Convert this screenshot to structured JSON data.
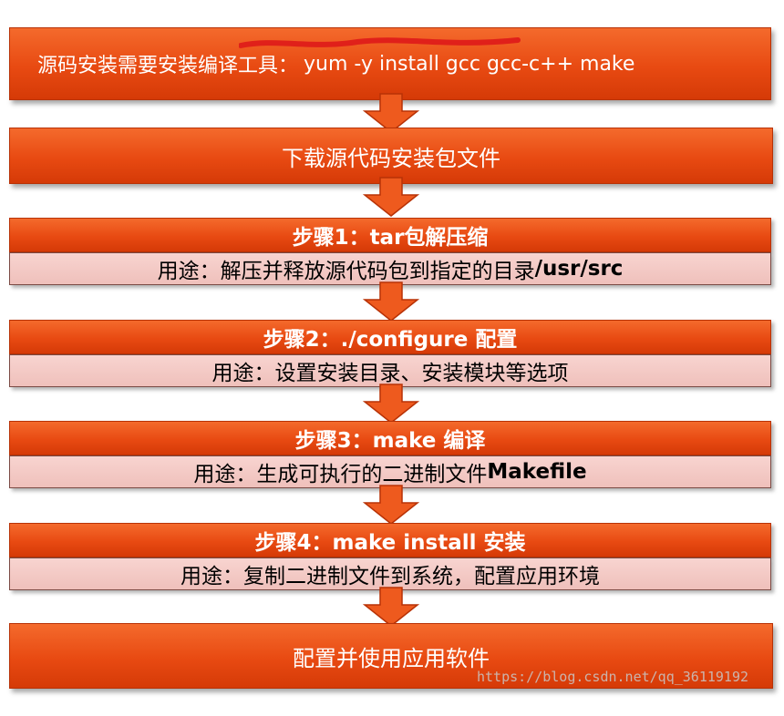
{
  "prereq": {
    "label": "源码安装需要安装编译工具：",
    "command": "yum -y install gcc gcc-c++ make"
  },
  "download": {
    "label": "下载源代码安装包文件"
  },
  "steps": [
    {
      "title": "步骤1：tar包解压缩",
      "purpose_prefix": "用途：",
      "purpose": "解压并释放源代码包到指定的目录",
      "purpose_bold": "/usr/src"
    },
    {
      "title": "步骤2：./configure 配置",
      "purpose_prefix": "用途：",
      "purpose": "设置安装目录、安装模块等选项",
      "purpose_bold": ""
    },
    {
      "title": "步骤3：make 编译",
      "purpose_prefix": "用途：",
      "purpose": "生成可执行的二进制文件",
      "purpose_bold": "Makefile"
    },
    {
      "title": "步骤4：make install 安装",
      "purpose_prefix": "用途：",
      "purpose": "复制二进制文件到系统，配置应用环境",
      "purpose_bold": ""
    }
  ],
  "final": {
    "label": "配置并使用应用软件"
  },
  "watermark": "https://blog.csdn.net/qq_36119192",
  "colors": {
    "box": "#e84a12",
    "sub": "#f4c9c4",
    "arrow": "#e84a12"
  }
}
